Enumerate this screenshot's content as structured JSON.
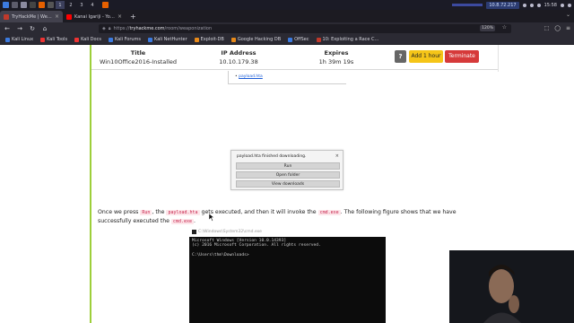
{
  "taskbar": {
    "workspaces": [
      "1",
      "2",
      "3",
      "4"
    ],
    "active_workspace": "1",
    "ip": "10.8.72.217",
    "time": "15:58"
  },
  "browser": {
    "tabs": [
      {
        "title": "TryHackMe | Weaponizati",
        "active": true
      },
      {
        "title": "Kanai Igariji - YouTube S",
        "active": false
      }
    ],
    "url_prefix": "https://",
    "url_host": "tryhackme.com",
    "url_path": "/room/weaponization",
    "zoom": "120%",
    "bookmarks": [
      "Kali Linux",
      "Kali Tools",
      "Kali Docs",
      "Kali Forums",
      "Kali NetHunter",
      "Exploit-DB",
      "Google Hacking DB",
      "OffSec",
      "10: Exploiting a Race C..."
    ]
  },
  "machine": {
    "title_label": "Title",
    "title_value": "Win10Office2016-Installed",
    "ip_label": "IP Address",
    "ip_value": "10.10.179.38",
    "expires_label": "Expires",
    "expires_value": "1h 39m 19s",
    "help_label": "?",
    "add_label": "Add 1 hour",
    "terminate_label": "Terminate"
  },
  "content": {
    "list_item": "payload.hta",
    "dialog_message": "payload.hta finished downloading.",
    "dialog_run": "Run",
    "dialog_open_folder": "Open folder",
    "dialog_view_downloads": "View downloads",
    "para_part1": "Once we press ",
    "para_code1": "Run",
    "para_part2": ", the ",
    "para_code2": "payload.hta",
    "para_part3": " gets executed, and then it will invoke the ",
    "para_code3": "cmd.exe",
    "para_part4": ". The following figure shows that we have successfully executed the ",
    "para_code4": "cmd.exe",
    "para_part5": ".",
    "cmd_window_title": "C:\\Windows\\System32\\cmd.exe",
    "cmd_output": "Microsoft Windows [Version 10.0.14393]\n(c) 2016 Microsoft Corporation. All rights reserved.\n\nC:\\Users\\thm\\Downloads>"
  }
}
